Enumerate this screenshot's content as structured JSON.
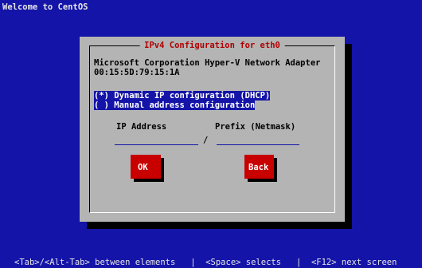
{
  "header": {
    "welcome": "Welcome to CentOS"
  },
  "dialog": {
    "title": "IPv4 Configuration for eth0",
    "adapter_name": "Microsoft Corporation Hyper-V Network Adapter",
    "mac_address": "00:15:5D:79:15:1A",
    "options": [
      {
        "label": "(*) Dynamic IP configuration (DHCP)"
      },
      {
        "label": "( ) Manual address configuration"
      }
    ],
    "ip_address_label": "IP Address",
    "prefix_label": "Prefix (Netmask)",
    "separator": "/",
    "ok_label": "OK",
    "back_label": "Back"
  },
  "status_bar": {
    "text": "<Tab>/<Alt-Tab> between elements   |  <Space> selects   |  <F12> next screen"
  },
  "colors": {
    "background": "#1414a8",
    "dialog": "#b4b4b4",
    "button": "#c80000",
    "title": "#b00000"
  }
}
